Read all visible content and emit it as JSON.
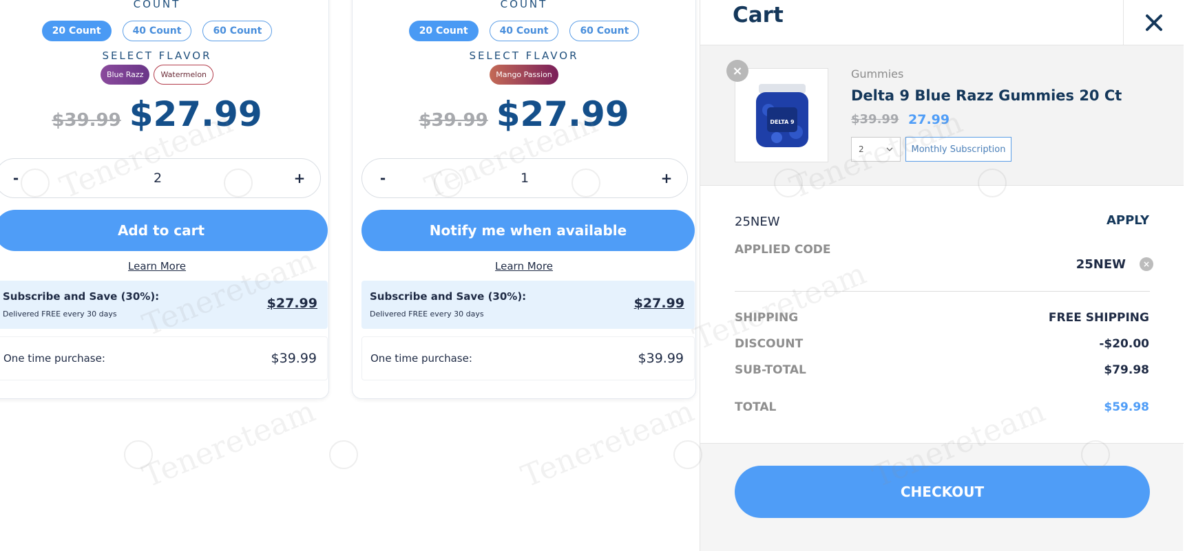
{
  "products": [
    {
      "count_label": "COUNT",
      "counts": [
        "20 Count",
        "40 Count",
        "60 Count"
      ],
      "flavor_label": "SELECT FLAVOR",
      "flavors": [
        "Blue Razz",
        "Watermelon"
      ],
      "old_price": "$39.99",
      "price": "$27.99",
      "qty_minus": "-",
      "quantity": "2",
      "qty_plus": "+",
      "cta": "Add to cart",
      "learn_more": "Learn More",
      "subscribe_title": "Subscribe and Save (30%):",
      "subscribe_note": "Delivered FREE every 30 days",
      "subscribe_price": "$27.99",
      "one_time_label": "One time purchase:",
      "one_time_price": "$39.99"
    },
    {
      "count_label": "COUNT",
      "counts": [
        "20 Count",
        "40 Count",
        "60 Count"
      ],
      "flavor_label": "SELECT FLAVOR",
      "flavors": [
        "Mango Passion"
      ],
      "old_price": "$39.99",
      "price": "$27.99",
      "qty_minus": "-",
      "quantity": "1",
      "qty_plus": "+",
      "cta": "Notify me when available",
      "learn_more": "Learn More",
      "subscribe_title": "Subscribe and Save (30%):",
      "subscribe_note": "Delivered FREE every 30 days",
      "subscribe_price": "$27.99",
      "one_time_label": "One time purchase:",
      "one_time_price": "$39.99"
    }
  ],
  "cart": {
    "title": "Cart",
    "close_icon": "close-icon",
    "item": {
      "category": "Gummies",
      "name": "Delta 9 Blue Razz Gummies 20 Ct",
      "old_price": "$39.99",
      "price": "27.99",
      "quantity": "2",
      "subscription_button": "Monthly Subscription",
      "jar_text": "DELTA 9"
    },
    "coupon": {
      "value": "25NEW",
      "apply": "APPLY",
      "applied_label": "APPLIED CODE",
      "applied_code": "25NEW"
    },
    "summary": {
      "shipping_label": "SHIPPING",
      "shipping_value": "FREE SHIPPING",
      "discount_label": "DISCOUNT",
      "discount_value": "-$20.00",
      "subtotal_label": "SUB-TOTAL",
      "subtotal_value": "$79.98",
      "total_label": "TOTAL",
      "total_value": "$59.98"
    },
    "checkout": "CHECKOUT"
  },
  "watermark": "Tenereteam",
  "colors": {
    "accent": "#4f9df7",
    "dark_navy": "#14375a",
    "price_blue": "#144f8a",
    "subscribe_bg": "#e6f2fd"
  }
}
